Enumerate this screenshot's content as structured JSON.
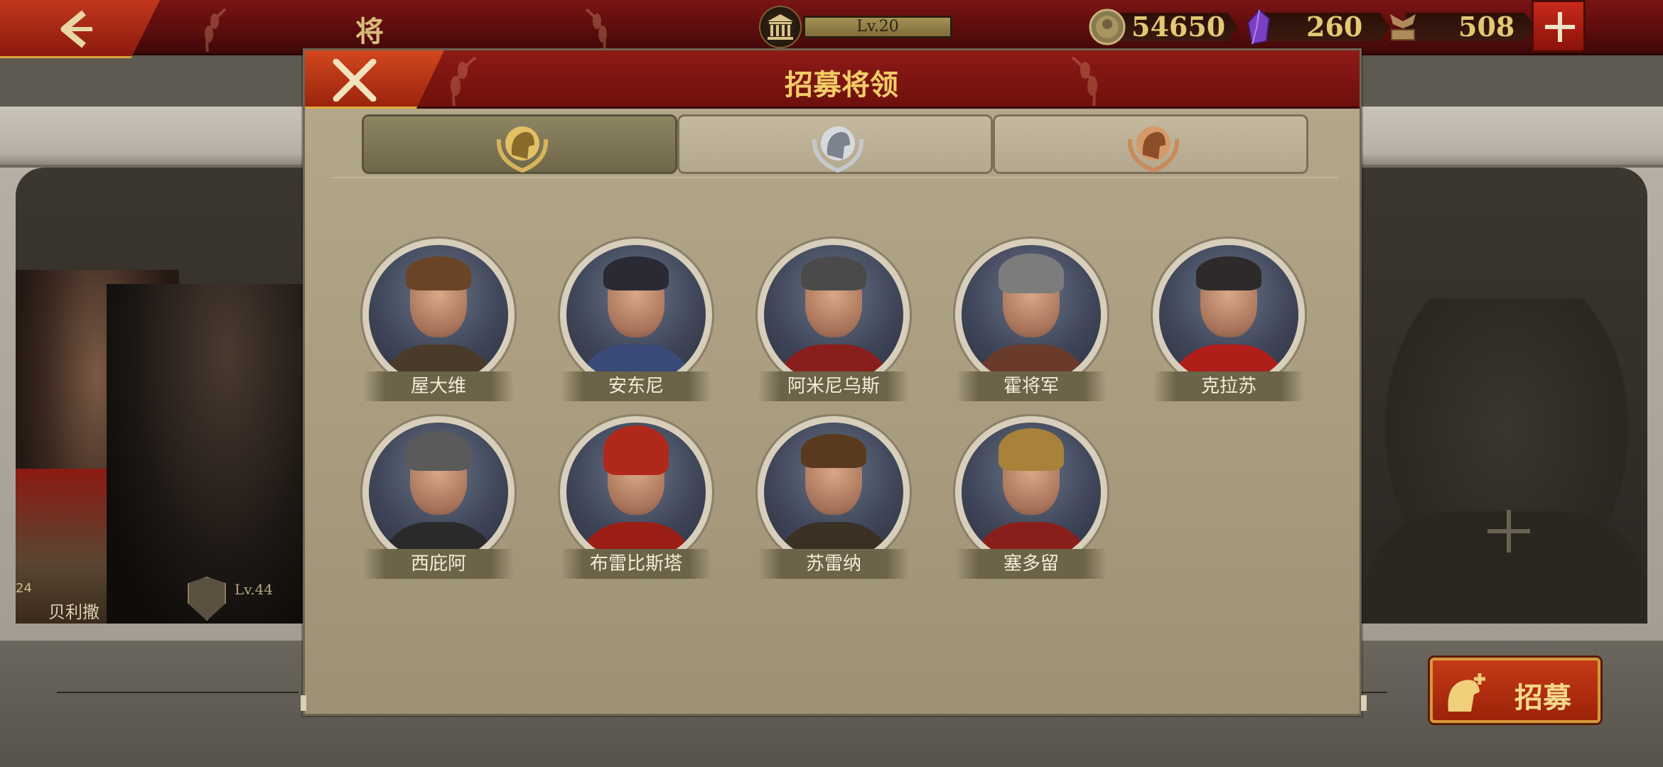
{
  "topbar": {
    "title": "将 领",
    "level": "Lv.20",
    "resources": [
      {
        "icon": "coin-icon",
        "value": "54650"
      },
      {
        "icon": "purple-gem-icon",
        "value": "260"
      },
      {
        "icon": "spqr-emblem-icon",
        "value": "508"
      }
    ],
    "add_button_icon": "plus-icon",
    "back_button_icon": "back-arrow-icon"
  },
  "background": {
    "general_name": "贝利撒",
    "general_level": "Lv.44",
    "level_small": "24",
    "recruit_button": "招募"
  },
  "modal": {
    "title": "招募将领",
    "close_icon": "close-icon",
    "tabs": [
      {
        "emblem": "gold-spartan-helmet-icon",
        "active": true
      },
      {
        "emblem": "silver-spartan-helmet-icon",
        "active": false
      },
      {
        "emblem": "bronze-spartan-helmet-icon",
        "active": false
      }
    ],
    "generals": [
      {
        "name": "屋大维"
      },
      {
        "name": "安东尼"
      },
      {
        "name": "阿米尼乌斯"
      },
      {
        "name": "霍将军"
      },
      {
        "name": "克拉苏"
      },
      {
        "name": "西庇阿"
      },
      {
        "name": "布雷比斯塔"
      },
      {
        "name": "苏雷纳"
      },
      {
        "name": "塞多留"
      }
    ]
  },
  "colors": {
    "header_red": "#7a1414",
    "gold_text": "#f3cd67",
    "parchment": "#b5a98c"
  }
}
